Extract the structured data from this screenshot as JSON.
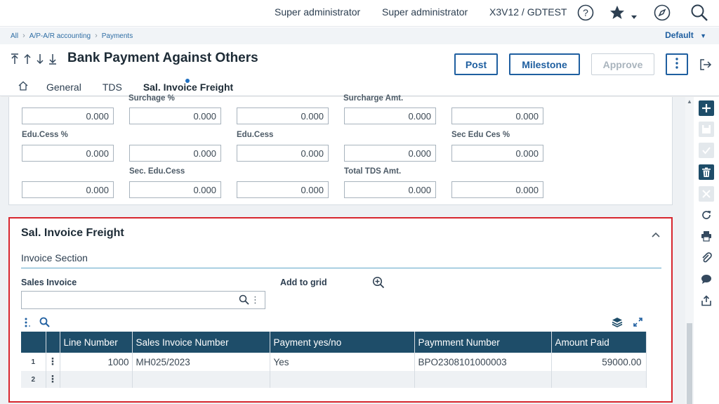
{
  "topbar": {
    "user1": "Super administrator",
    "user2": "Super administrator",
    "folder": "X3V12 / GDTEST",
    "icons": [
      "help-icon",
      "star-icon",
      "compass-icon",
      "search-icon"
    ]
  },
  "breadcrumb": {
    "items": [
      "All",
      "A/P-A/R accounting",
      "Payments"
    ],
    "default_label": "Default"
  },
  "header": {
    "title": "Bank Payment Against Others",
    "buttons": {
      "post": "Post",
      "milestone": "Milestone",
      "approve": "Approve"
    },
    "tabs": [
      "General",
      "TDS",
      "Sal. Invoice Freight"
    ]
  },
  "tds_section": {
    "labels": {
      "surcharge_pct": "Surchage %",
      "surcharge_amt": "Surcharge Amt.",
      "edu_cess_pct": "Edu.Cess %",
      "edu_cess": "Edu.Cess",
      "sec_edu_ces_pct": "Sec Edu Ces %",
      "sec_edu_cess": "Sec. Edu.Cess",
      "total_tds_amt": "Total TDS Amt."
    },
    "row1": [
      "0.000",
      "0.000",
      "0.000",
      "0.000",
      "0.000"
    ],
    "row2": [
      "0.000",
      "0.000",
      "0.000",
      "0.000",
      "0.000"
    ],
    "row3": [
      "0.000",
      "0.000",
      "0.000",
      "0.000",
      "0.000"
    ]
  },
  "freight_section": {
    "title": "Sal. Invoice Freight",
    "subtitle": "Invoice Section",
    "sales_invoice_label": "Sales Invoice",
    "sales_invoice_value": "",
    "add_to_grid_label": "Add to grid",
    "grid": {
      "columns": [
        "Line Number",
        "Sales Invoice Number",
        "Payment yes/no",
        "Paymment Number",
        "Amount Paid"
      ],
      "rows": [
        {
          "num": "1",
          "line": "1000",
          "invoice": "MH025/2023",
          "payment": "Yes",
          "payment_number": "BPO2308101000003",
          "amount": "59000.00"
        },
        {
          "num": "2",
          "line": "",
          "invoice": "",
          "payment": "",
          "payment_number": "",
          "amount": ""
        }
      ]
    }
  }
}
